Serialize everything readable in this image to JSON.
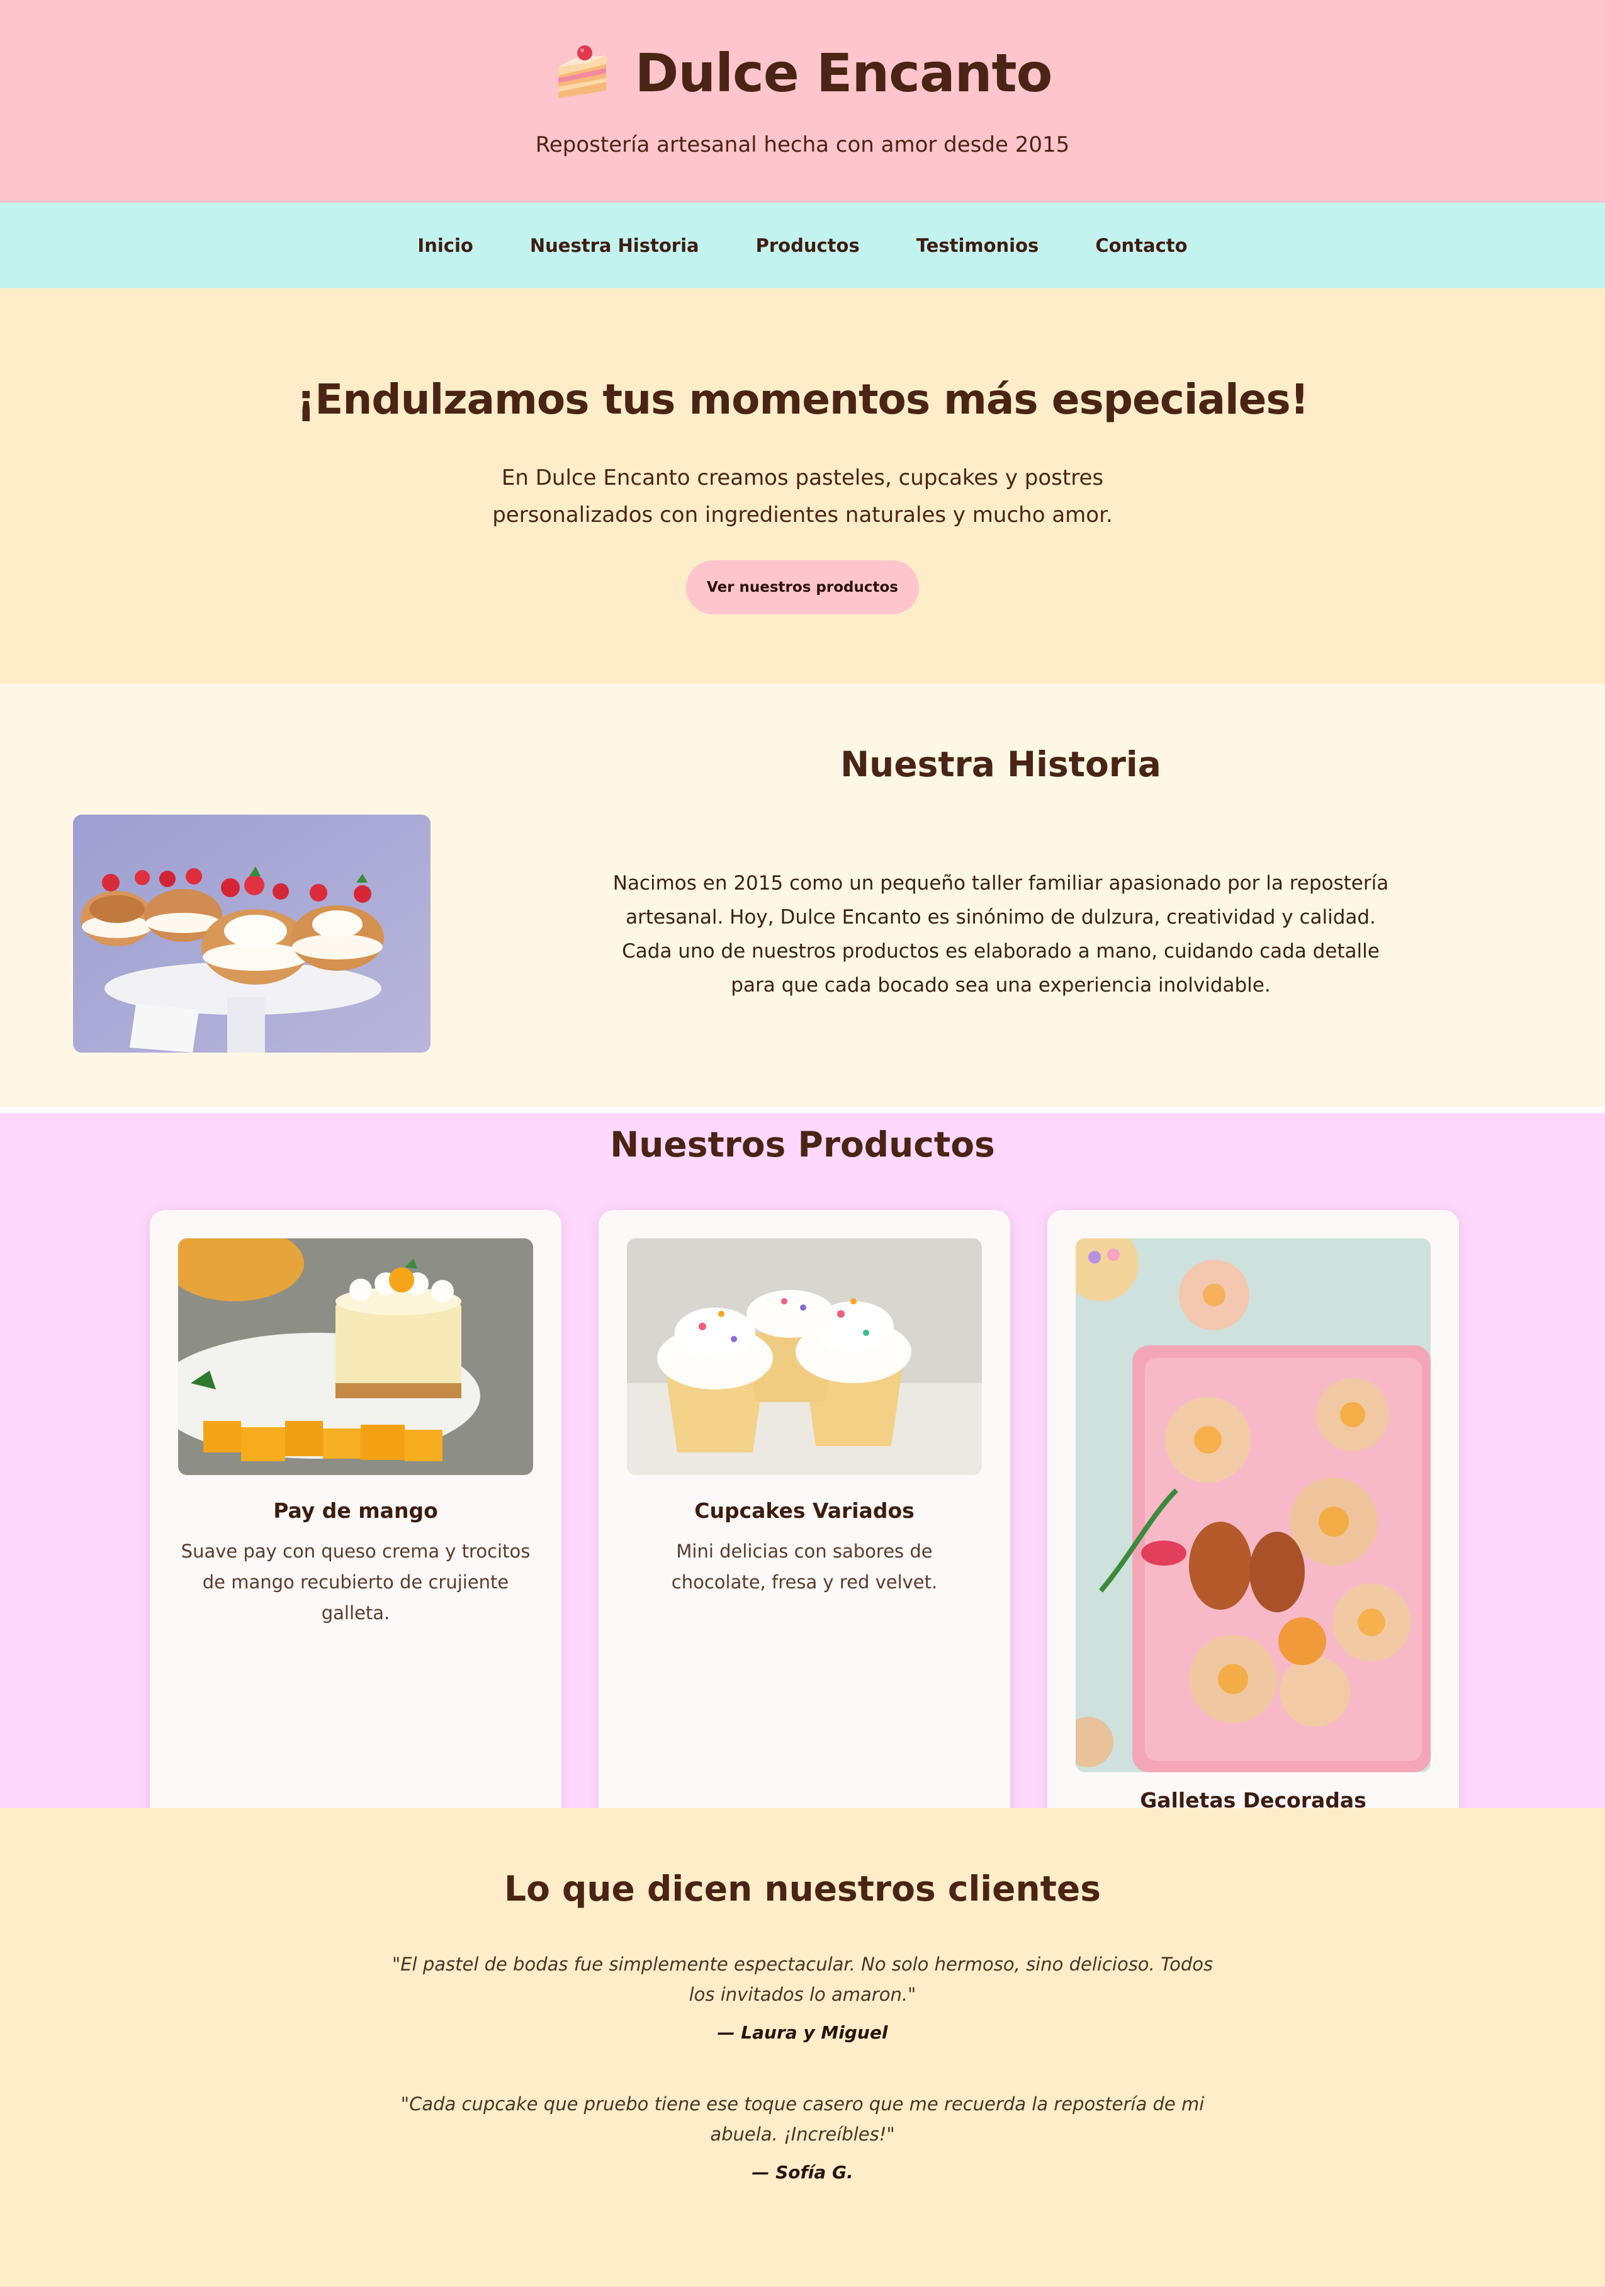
{
  "header": {
    "logo_icon": "cake-slice-icon",
    "title": "Dulce Encanto",
    "tagline": "Repostería artesanal hecha con amor desde 2015"
  },
  "nav": {
    "items": [
      {
        "label": "Inicio"
      },
      {
        "label": "Nuestra Historia"
      },
      {
        "label": "Productos"
      },
      {
        "label": "Testimonios"
      },
      {
        "label": "Contacto"
      }
    ]
  },
  "hero": {
    "title": "¡Endulzamos tus momentos más especiales!",
    "text": "En Dulce Encanto creamos pasteles, cupcakes y postres personalizados con ingredientes naturales y mucho amor.",
    "button_label": "Ver nuestros productos"
  },
  "historia": {
    "title": "Nuestra Historia",
    "text": "Nacimos en 2015 como un pequeño taller familiar apasionado por la repostería artesanal. Hoy, Dulce Encanto es sinónimo de dulzura, creatividad y calidad. Cada uno de nuestros productos es elaborado a mano, cuidando cada detalle para que cada bocado sea una experiencia inolvidable."
  },
  "productos": {
    "title": "Nuestros Productos",
    "cards": [
      {
        "title": "Pay de mango",
        "description": "Suave pay con queso crema y trocitos de mango recubierto de crujiente galleta."
      },
      {
        "title": "Cupcakes Variados",
        "description": "Mini delicias con sabores de chocolate, fresa y red velvet."
      },
      {
        "title": "Galletas Decoradas",
        "description": ""
      }
    ]
  },
  "testimonios": {
    "title": "Lo que dicen nuestros clientes",
    "items": [
      {
        "quote": "\"El pastel de bodas fue simplemente espectacular. No solo hermoso, sino delicioso. Todos los invitados lo amaron.\"",
        "author": "— Laura y Miguel"
      },
      {
        "quote": "\"Cada cupcake que pruebo tiene ese toque casero que me recuerda la repostería de mi abuela. ¡Increíbles!\"",
        "author": "— Sofía G."
      }
    ]
  },
  "colors": {
    "header_bg": "#ffc5cd",
    "nav_bg": "#c3f3ef",
    "hero_bg": "#ffedc9",
    "historia_bg": "#fef7e6",
    "productos_bg": "#fed8fd",
    "text_brown": "#4a2414"
  }
}
